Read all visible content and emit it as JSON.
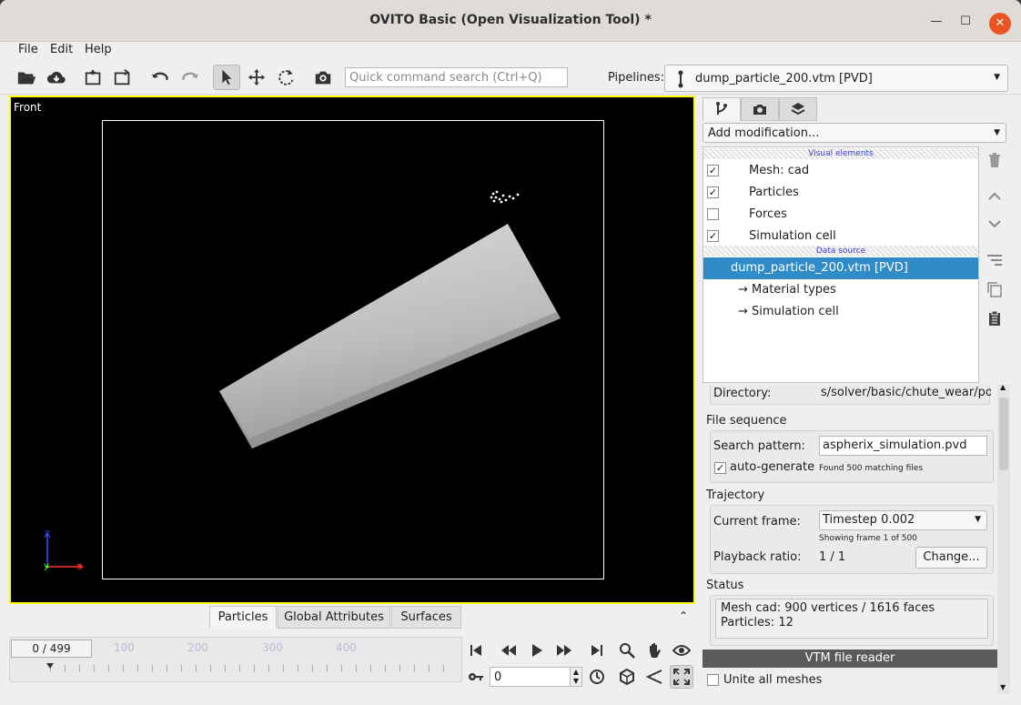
{
  "window": {
    "title": "OVITO Basic (Open Visualization Tool) *"
  },
  "menu": {
    "file": "File",
    "edit": "Edit",
    "help": "Help"
  },
  "toolbar": {
    "search_placeholder": "Quick command search (Ctrl+Q)",
    "pipelines_label": "Pipelines:",
    "pipeline_selected": "dump_particle_200.vtm [PVD]"
  },
  "viewport": {
    "label": "Front",
    "axes": {
      "z": "z",
      "y": "y",
      "x": "x"
    }
  },
  "bottom_tabs": [
    "Particles",
    "Global Attributes",
    "Surfaces"
  ],
  "animation": {
    "frame_indicator": "0 / 499",
    "ticks": [
      "100",
      "200",
      "300",
      "400"
    ],
    "frame_value": "0"
  },
  "panel": {
    "add_modification": "Add modification...",
    "visual_elements_header": "Visual elements",
    "visual_elements": [
      {
        "label": "Mesh: cad",
        "checked": "✓"
      },
      {
        "label": "Particles",
        "checked": "✓"
      },
      {
        "label": "Forces",
        "checked": ""
      },
      {
        "label": "Simulation cell",
        "checked": "✓"
      }
    ],
    "data_source_header": "Data source",
    "data_source": "dump_particle_200.vtm [PVD]",
    "sub_items": [
      "→ Material types",
      "→ Simulation cell"
    ]
  },
  "props": {
    "directory_label": "Directory:",
    "directory_value": "s/solver/basic/chute_wear/post",
    "file_sequence_title": "File sequence",
    "search_pattern_label": "Search pattern:",
    "search_pattern_value": "aspherix_simulation.pvd",
    "auto_generate_label": "auto-generate",
    "auto_generate_check": "✓",
    "found_files": "Found 500 matching files",
    "trajectory_title": "Trajectory",
    "current_frame_label": "Current frame:",
    "current_frame_value": "Timestep 0.002",
    "showing_frame": "Showing frame 1 of 500",
    "playback_label": "Playback ratio:",
    "playback_value": "1 / 1",
    "change_button": "Change...",
    "status_title": "Status",
    "status_line1": "Mesh cad: 900 vertices / 1616 faces",
    "status_line2": "Particles: 12",
    "reader_title": "VTM file reader",
    "unite_label": "Unite all meshes"
  }
}
